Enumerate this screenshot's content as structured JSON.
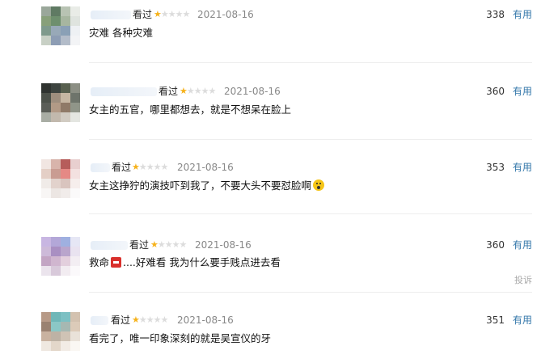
{
  "comments": [
    {
      "status": "看过",
      "rating": 1,
      "max_rating": 5,
      "date": "2021-08-16",
      "votes": "338",
      "useful_label": "有用",
      "text": "灾难 各种灾难",
      "avatar_colors": [
        "#9aa79a",
        "#5f7a63",
        "#b8c3b3",
        "#e9ece7",
        "#88a07a",
        "#6e8f6e",
        "#a7b6a0",
        "#dfe4df",
        "#7f9a8c",
        "#98a9b8",
        "#8aa0b6",
        "#eef1f4",
        "#c8d0c5",
        "#8d9db4",
        "#b3bcc9",
        "#f3f4f6"
      ]
    },
    {
      "status": "看过",
      "rating": 1,
      "max_rating": 5,
      "date": "2021-08-16",
      "votes": "360",
      "useful_label": "有用",
      "text": "女主的五官，哪里都想去，就是不想呆在脸上",
      "avatar_colors": [
        "#2f3330",
        "#3d4440",
        "#58604f",
        "#8c8f84",
        "#4c514a",
        "#9e8e7e",
        "#c6b7a3",
        "#6e746b",
        "#5a5d57",
        "#b29a86",
        "#8f7a68",
        "#909589",
        "#a9ada4",
        "#c2b9ad",
        "#d1cbc2",
        "#e4e6e1"
      ]
    },
    {
      "status": "看过",
      "rating": 1,
      "max_rating": 5,
      "date": "2021-08-16",
      "votes": "353",
      "useful_label": "有用",
      "text": "女主这挣狞的演技吓到我了，不要大头不要怼脸啊",
      "avatar_colors": [
        "#f1e6e2",
        "#d8b4ab",
        "#b65d5b",
        "#e8cfcf",
        "#e4cfc6",
        "#c99c92",
        "#e58985",
        "#f3e1e0",
        "#f0ebe8",
        "#e2d2cc",
        "#d9c4be",
        "#f6eeec",
        "#f8f6f5",
        "#ece6e3",
        "#f1ecea",
        "#fbfafa"
      ]
    },
    {
      "status": "看过",
      "rating": 1,
      "max_rating": 5,
      "date": "2021-08-16",
      "votes": "360",
      "useful_label": "有用",
      "text_before": "救命",
      "text_after": "....好难看 我为什么要手贱点进去看",
      "report_label": "投诉",
      "avatar_colors": [
        "#c8b6e2",
        "#b3a7d8",
        "#9fb0e0",
        "#e6e7f5",
        "#cdbad9",
        "#a98fc2",
        "#b9a5cc",
        "#e9e3f0",
        "#c3a5c4",
        "#d0b6cf",
        "#e3cfdd",
        "#f3eef3",
        "#ebe4ed",
        "#d8c9da",
        "#f2ecf1",
        "#fbf9fb"
      ]
    },
    {
      "status": "看过",
      "rating": 1,
      "max_rating": 5,
      "date": "2021-08-16",
      "votes": "351",
      "useful_label": "有用",
      "text": "看完了，唯一印象深刻的就是吴宣仪的牙",
      "avatar_colors": [
        "#b79a87",
        "#6fb7b8",
        "#7cc0c3",
        "#d3c2b0",
        "#9a8271",
        "#8bc7c6",
        "#a6b8b2",
        "#dccbb9",
        "#c9b2a0",
        "#bdb2a5",
        "#cfc3b5",
        "#e9e2d9",
        "#efe8e0",
        "#e3d7ca",
        "#f2ece5",
        "#faf7f3"
      ]
    }
  ]
}
